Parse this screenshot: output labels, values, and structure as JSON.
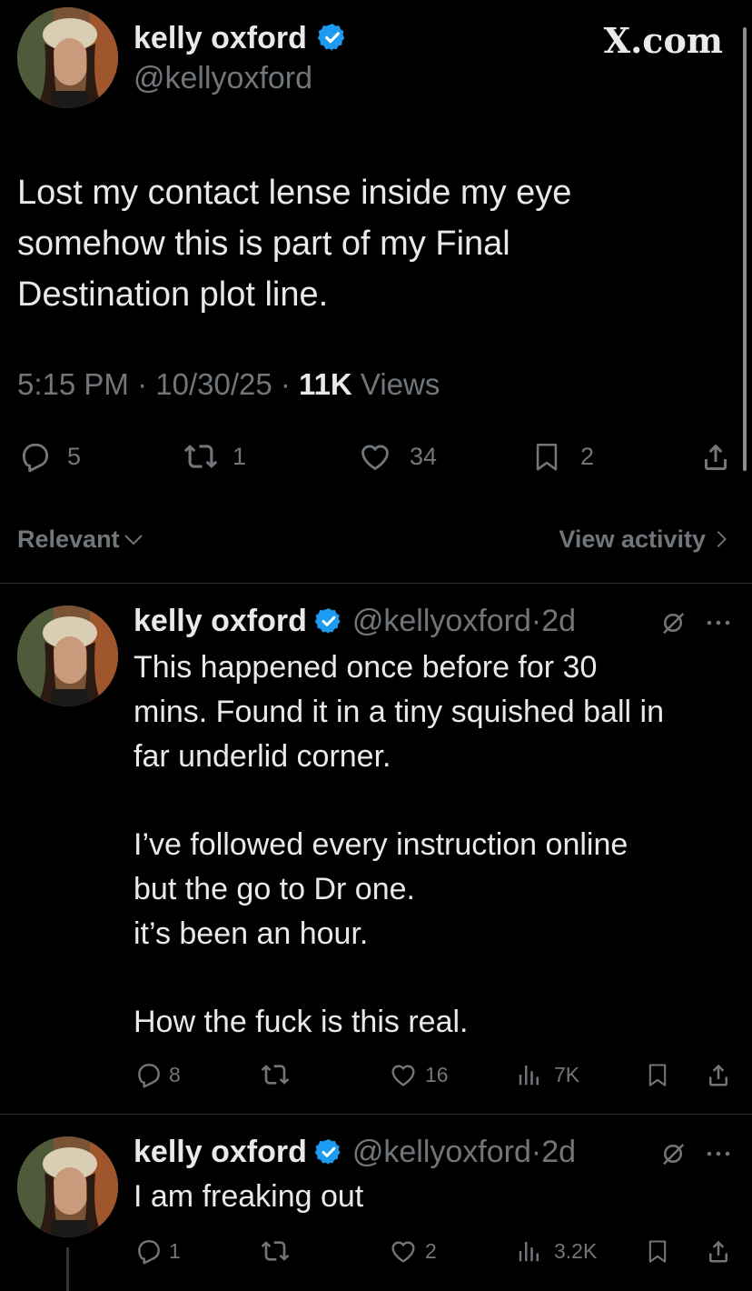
{
  "brand": "X.com",
  "main_tweet": {
    "display_name": "kelly oxford",
    "handle": "@kellyoxford",
    "text": "Lost my contact lense inside my eye\nsomehow this is part of my Final\nDestination plot line.",
    "time": "5:15 PM",
    "date": "10/30/25",
    "views_count": "11K",
    "views_label": "Views",
    "replies": "5",
    "reposts": "1",
    "likes": "34",
    "bookmarks": "2"
  },
  "sort": {
    "label": "Relevant",
    "view_activity": "View activity"
  },
  "replies": [
    {
      "display_name": "kelly oxford",
      "handle": "@kellyoxford",
      "age": "2d",
      "text": "This happened once before for 30\nmins. Found it in a tiny squished ball in\nfar underlid corner.\n\nI’ve followed every instruction online\nbut the go to Dr one.\nit’s been an hour.\n\nHow the fuck is this real.",
      "replies": "8",
      "reposts": "",
      "likes": "16",
      "views": "7K"
    },
    {
      "display_name": "kelly oxford",
      "handle": "@kellyoxford",
      "age": "2d",
      "text": "I am freaking out",
      "replies": "1",
      "reposts": "",
      "likes": "2",
      "views": "3.2K"
    }
  ],
  "colors": {
    "background": "#000000",
    "text": "#e7e9ea",
    "muted": "#71767b",
    "verified": "#1d9bf0",
    "divider": "#2f3336"
  }
}
